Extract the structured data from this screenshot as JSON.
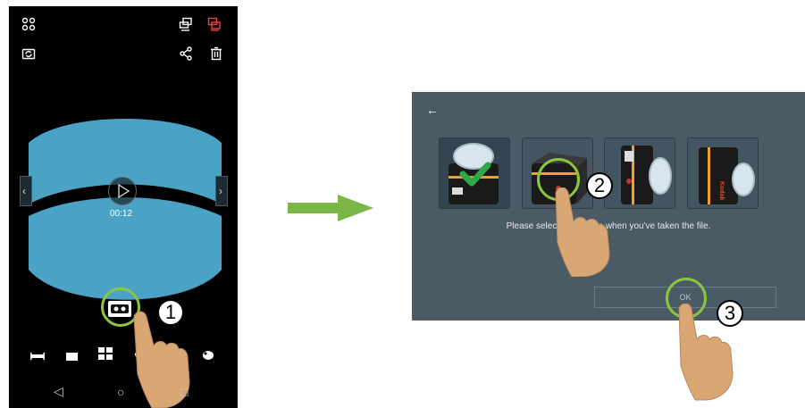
{
  "phone": {
    "top_left_icon": "grid-icon",
    "top_right_icons": [
      "screen-cast-icon",
      "vr-screen-icon"
    ],
    "second_row_left_icon": "camera-switch-icon",
    "second_row_right_icons": [
      "share-icon",
      "trash-icon"
    ],
    "timestamp": "00:12",
    "mode_icons": [
      "panorama-icon",
      "single-view-icon",
      "quad-view-icon",
      "sphere-icon",
      "dome-icon",
      "globe-icon"
    ],
    "nav": {
      "back": "◁",
      "home": "○",
      "recent": "□"
    },
    "accent_color": "#e94545"
  },
  "dialog": {
    "back_icon": "←",
    "message": "Please select a direction when you've taken the file.",
    "ok_label": "OK",
    "camera_options": [
      "camera-up-option",
      "camera-front-option",
      "camera-side-option",
      "camera-angled-option"
    ],
    "camera_brand": "Kodak"
  },
  "steps": [
    "1",
    "2",
    "3"
  ],
  "colors": {
    "highlight": "#8cc63f",
    "arrow": "#7ab648",
    "dialog_bg": "#4a5b66",
    "video_blue": "#4aa3c4"
  }
}
